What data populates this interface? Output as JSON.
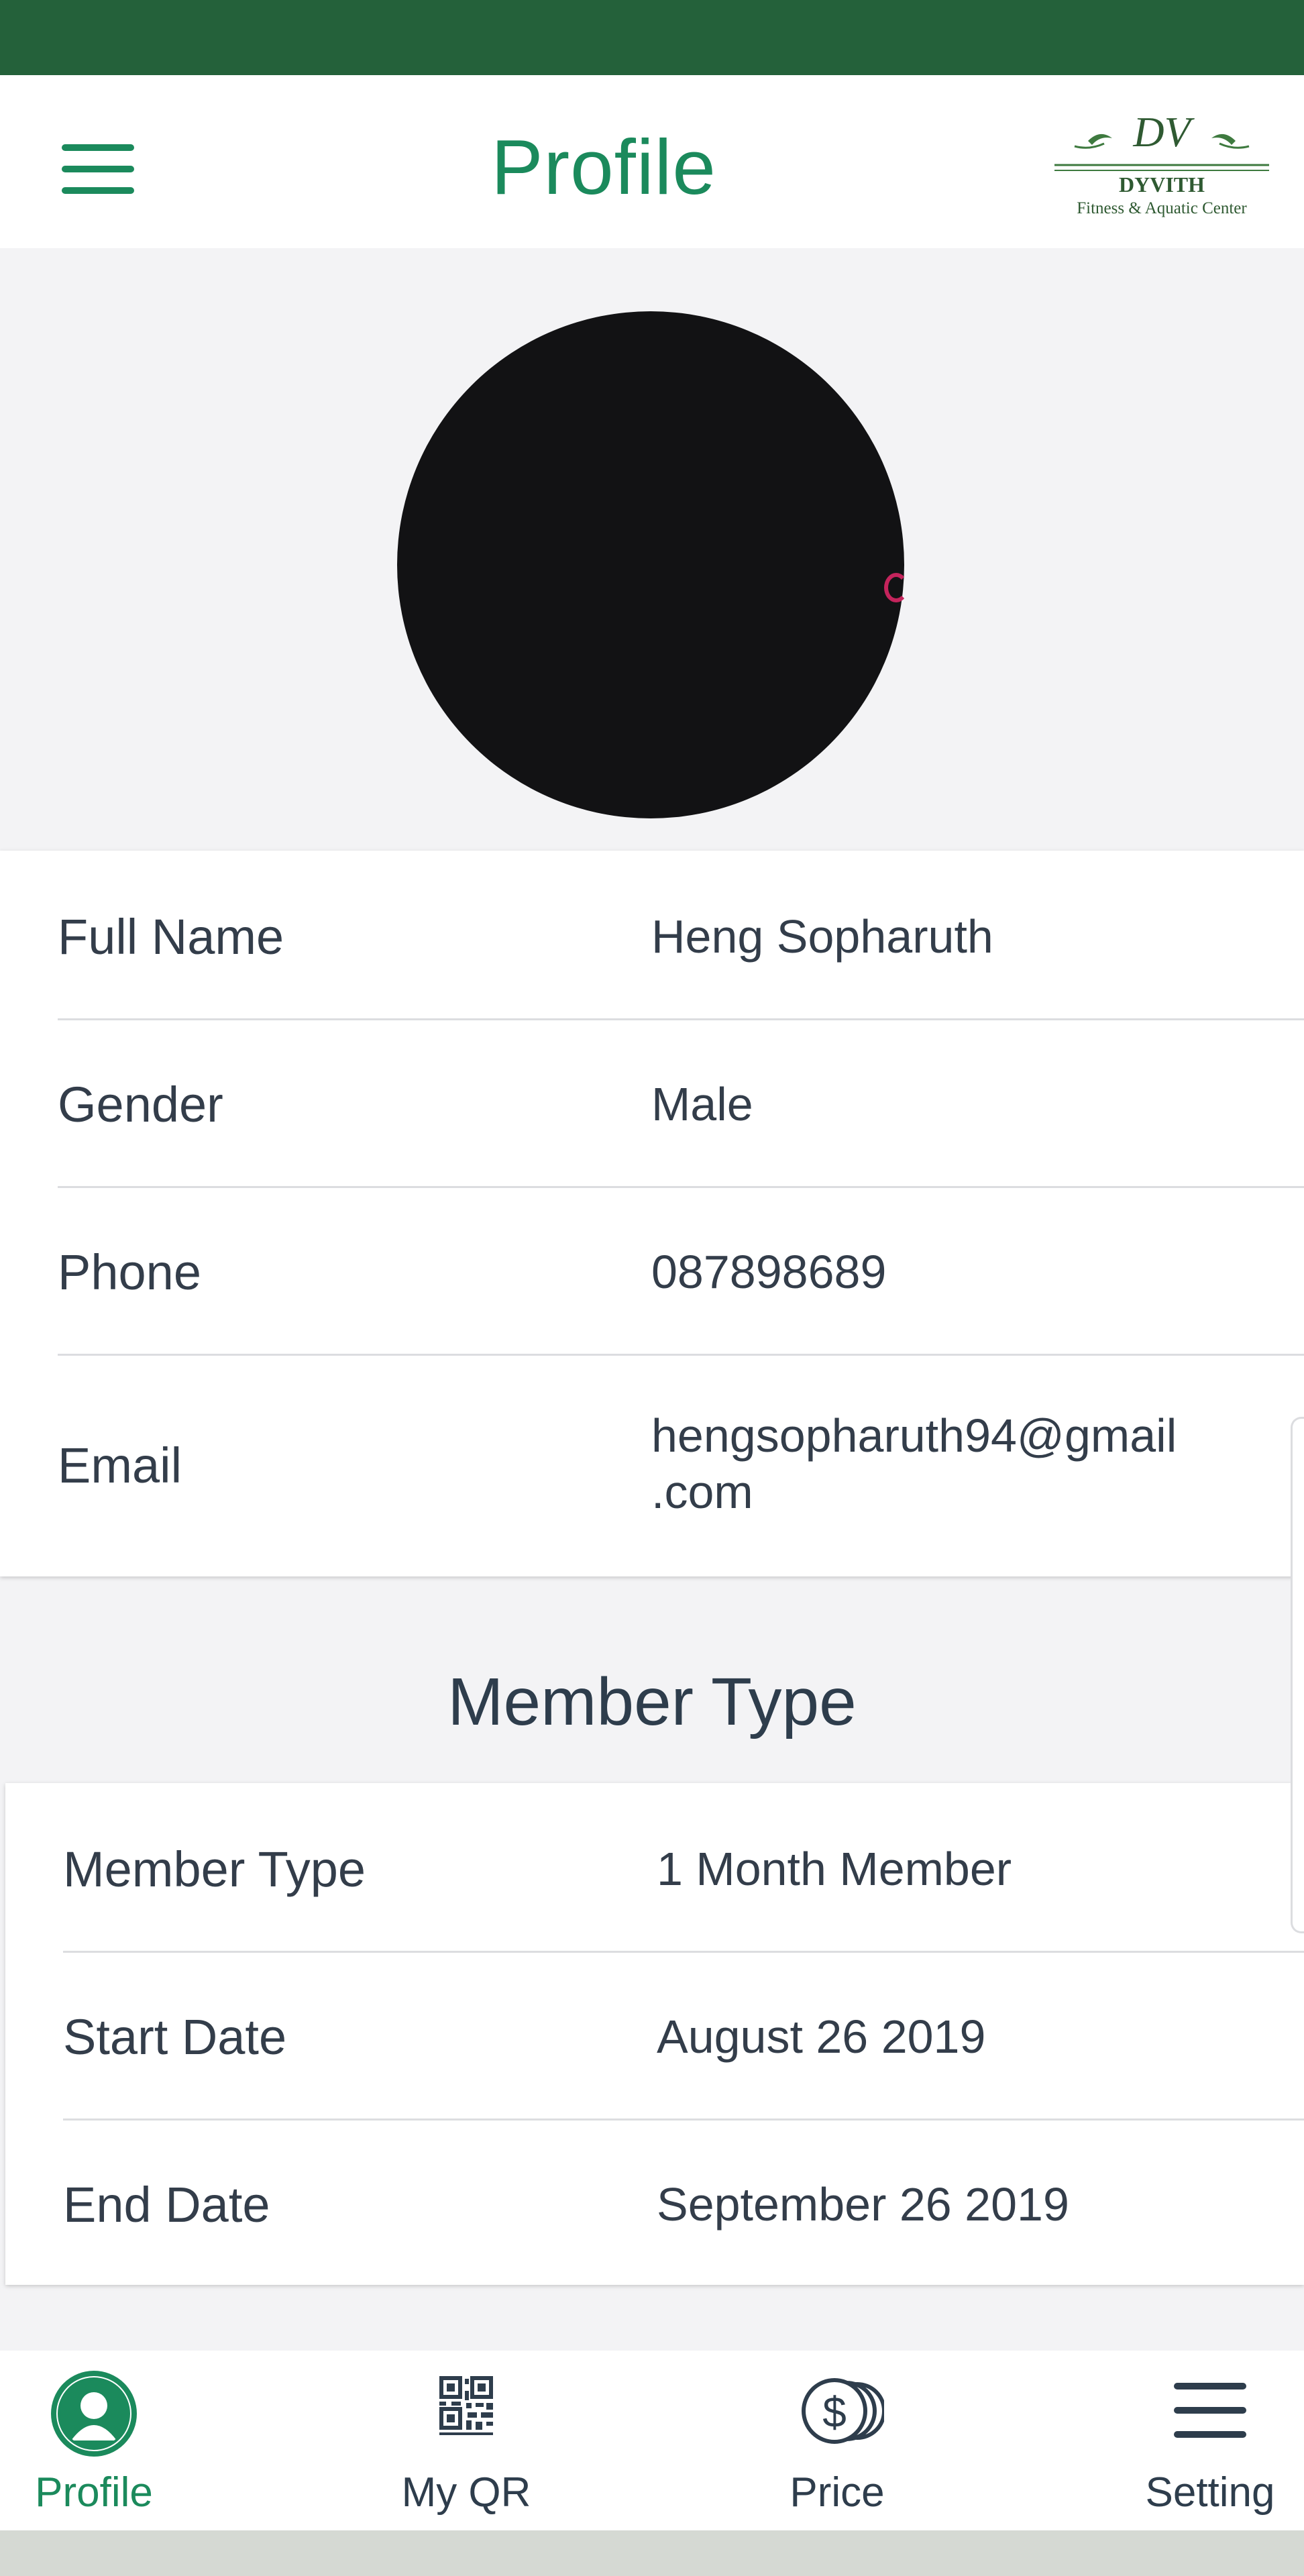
{
  "header": {
    "title": "Profile",
    "logo": {
      "monogram": "DV",
      "name": "DYVITH",
      "tagline": "Fitness & Aquatic Center"
    }
  },
  "profile": {
    "rows": [
      {
        "label": "Full Name",
        "value": "Heng Sopharuth"
      },
      {
        "label": "Gender",
        "value": "Male"
      },
      {
        "label": "Phone",
        "value": "087898689"
      },
      {
        "label": "Email",
        "value": "hengsopharuth94@gmail\n.com"
      }
    ]
  },
  "membership": {
    "section_title": "Member Type",
    "rows": [
      {
        "label": "Member Type",
        "value": "1 Month Member"
      },
      {
        "label": "Start Date",
        "value": "August 26 2019"
      },
      {
        "label": "End Date",
        "value": "September 26 2019"
      }
    ]
  },
  "bottom_nav": {
    "items": [
      {
        "label": "Profile",
        "icon": "profile-icon",
        "active": true
      },
      {
        "label": "My QR",
        "icon": "qr-code-icon",
        "active": false
      },
      {
        "label": "Price",
        "icon": "coins-icon",
        "active": false
      },
      {
        "label": "Setting",
        "icon": "menu-icon",
        "active": false
      }
    ]
  },
  "colors": {
    "status_bar": "#24613a",
    "accent": "#1b8a5c",
    "text": "#333d4a",
    "background": "#f3f3f5"
  }
}
